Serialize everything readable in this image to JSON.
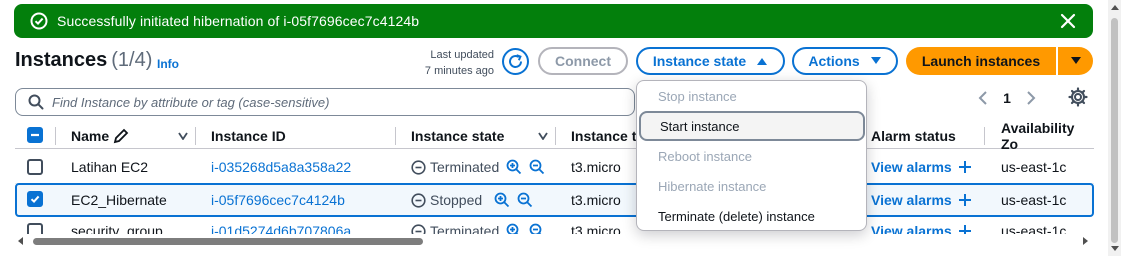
{
  "flash": {
    "message": "Successfully initiated hibernation of i-05f7696cec7c4124b",
    "color": "#037f0c"
  },
  "header": {
    "title": "Instances",
    "count": "(1/4)",
    "info": "Info",
    "last_updated_line1": "Last updated",
    "last_updated_line2": "7 minutes ago",
    "connect": "Connect",
    "instance_state": "Instance state",
    "actions": "Actions",
    "launch": "Launch instances"
  },
  "search": {
    "placeholder": "Find Instance by attribute or tag (case-sensitive)"
  },
  "pagination": {
    "page": "1"
  },
  "columns": {
    "name": "Name",
    "instance_id": "Instance ID",
    "instance_state": "Instance state",
    "instance_type": "Instance t",
    "alarm_status": "Alarm status",
    "availability_zone": "Availability Zo"
  },
  "rows": [
    {
      "name": "Latihan EC2",
      "id": "i-035268d5a8a358a22",
      "state": "Terminated",
      "type": "t3.micro",
      "alarm": "View alarms",
      "az": "us-east-1c",
      "selected": false
    },
    {
      "name": "EC2_Hibernate",
      "id": "i-05f7696cec7c4124b",
      "state": "Stopped",
      "type": "t3.micro",
      "alarm": "View alarms",
      "az": "us-east-1c",
      "selected": true
    },
    {
      "name": "security_group",
      "id": "i-01d5274d6b707806a",
      "state": "Terminated",
      "type": "t3.micro",
      "alarm": "View alarms",
      "az": "us-east-1c",
      "selected": false
    }
  ],
  "menu": {
    "items": [
      {
        "label": "Stop instance",
        "enabled": false
      },
      {
        "label": "Start instance",
        "enabled": true
      },
      {
        "label": "Reboot instance",
        "enabled": false
      },
      {
        "label": "Hibernate instance",
        "enabled": false
      },
      {
        "label": "Terminate (delete) instance",
        "enabled": true
      }
    ]
  },
  "colors": {
    "accent": "#0972d3",
    "launch": "#ff9900",
    "success": "#037f0c"
  }
}
